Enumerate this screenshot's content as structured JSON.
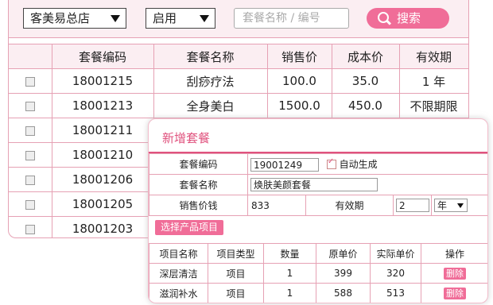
{
  "toolbar": {
    "store_select": "客美易总店",
    "status_select": "启用",
    "search_placeholder": "套餐名称 / 编号",
    "search_button": "搜索"
  },
  "list": {
    "columns": [
      "",
      "套餐编码",
      "套餐名称",
      "销售价",
      "成本价",
      "有效期"
    ],
    "rows": [
      {
        "code": "18001215",
        "name": "刮痧疗法",
        "price": "100.0",
        "cost": "35.0",
        "validity": "1 年"
      },
      {
        "code": "18001213",
        "name": "全身美白",
        "price": "1500.0",
        "cost": "450.0",
        "validity": "不限期限"
      },
      {
        "code": "18001211",
        "name": "",
        "price": "",
        "cost": "",
        "validity": ""
      },
      {
        "code": "18001210",
        "name": "",
        "price": "",
        "cost": "",
        "validity": ""
      },
      {
        "code": "18001206",
        "name": "",
        "price": "",
        "cost": "",
        "validity": ""
      },
      {
        "code": "18001205",
        "name": "",
        "price": "",
        "cost": "",
        "validity": ""
      },
      {
        "code": "18001203",
        "name": "",
        "price": "",
        "cost": "",
        "validity": ""
      }
    ]
  },
  "modal": {
    "title": "新增套餐",
    "code_label": "套餐编码",
    "code_value": "19001249",
    "auto_generate_label": "自动生成",
    "name_label": "套餐名称",
    "name_value": "焕肤美颜套餐",
    "price_label": "销售价钱",
    "price_value": "833",
    "validity_label": "有效期",
    "validity_value": "2",
    "validity_unit": "年",
    "select_products_button": "选择产品项目",
    "items_columns": [
      "项目名称",
      "项目类型",
      "数量",
      "原单价",
      "实际单价",
      "操作"
    ],
    "items": [
      {
        "name": "深层清洁",
        "type": "项目",
        "qty": "1",
        "orig_price": "399",
        "actual_price": "320",
        "action": "删除"
      },
      {
        "name": "滋润补水",
        "type": "项目",
        "qty": "1",
        "orig_price": "588",
        "actual_price": "513",
        "action": "删除"
      }
    ]
  },
  "colors": {
    "accent": "#f06d98",
    "border": "#e6a1b4",
    "header_bg": "#fbeef2"
  }
}
